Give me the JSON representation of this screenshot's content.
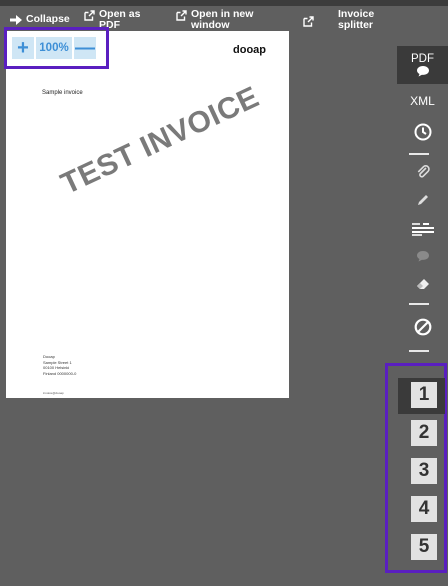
{
  "toolbar": {
    "collapse": "Collapse",
    "open_pdf_line1": "Open as",
    "open_pdf_line2": "PDF",
    "open_window_line1": "Open in new",
    "open_window_line2": "window",
    "splitter_line1": "Invoice",
    "splitter_line2": "splitter"
  },
  "zoom": {
    "level": "100%",
    "plus": "+",
    "minus": "—"
  },
  "document": {
    "logo": "dooap",
    "title": "Sample invoice",
    "watermark": "TEST INVOICE",
    "address": [
      "Dooap",
      "Sample Street 1",
      "00100 Helsinki",
      "Finland 0000000-0"
    ],
    "footer": "invoice@dooap"
  },
  "sidebar": {
    "pdf": "PDF",
    "xml": "XML"
  },
  "pages": [
    "1",
    "2",
    "3",
    "4",
    "5"
  ],
  "colors": {
    "background": "#5f5f5f",
    "highlight": "#5a1fc0",
    "zoom_button": "#cfe6f5",
    "zoom_text": "#3d8fd6"
  }
}
